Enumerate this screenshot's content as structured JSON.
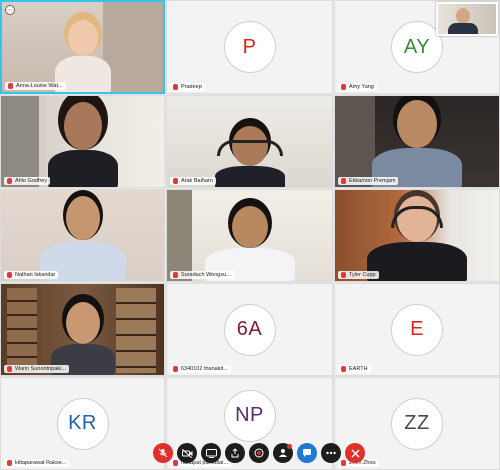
{
  "participants": [
    {
      "name": "Anna-Louise Wat...",
      "type": "video",
      "active": true
    },
    {
      "name": "Pradeep",
      "type": "avatar",
      "initials": "P",
      "color": "#d9231c"
    },
    {
      "name": "Amy Yang",
      "type": "avatar",
      "initials": "AY",
      "color": "#3a8a3e"
    },
    {
      "name": "Ahlo Godfrey",
      "type": "video"
    },
    {
      "name": "Arak Baiharn",
      "type": "video"
    },
    {
      "name": "Ekkamon Premjam",
      "type": "video"
    },
    {
      "name": "Nathan Iskandar",
      "type": "video"
    },
    {
      "name": "Suradach Wongsu...",
      "type": "video"
    },
    {
      "name": "Tyler Cupp",
      "type": "video"
    },
    {
      "name": "Warin Sunontnpaki...",
      "type": "video"
    },
    {
      "name": "6340102 thanakit...",
      "type": "avatar",
      "initials": "6A",
      "color": "#7a1d3a"
    },
    {
      "name": "EARTH",
      "type": "avatar",
      "initials": "E",
      "color": "#d9231c"
    },
    {
      "name": "kittaparawat Rakse...",
      "type": "avatar",
      "initials": "KR",
      "color": "#1f5fae"
    },
    {
      "name": "nattapat pannutai...",
      "type": "avatar",
      "initials": "NP",
      "color": "#5a2a6e"
    },
    {
      "name": "Zhen Zhou",
      "type": "avatar",
      "initials": "ZZ",
      "color": "#4a4a4a"
    }
  ],
  "menu_icon": "more-options-icon",
  "toolbar": [
    {
      "icon": "mic-off-icon",
      "style": "red"
    },
    {
      "icon": "video-off-icon",
      "style": "dark"
    },
    {
      "icon": "screen-share-icon",
      "style": "dark"
    },
    {
      "icon": "share-upload-icon",
      "style": "dark"
    },
    {
      "icon": "record-icon",
      "style": "dark"
    },
    {
      "icon": "participants-icon",
      "style": "dark",
      "badge": true
    },
    {
      "icon": "chat-icon",
      "style": "blue"
    },
    {
      "icon": "more-icon",
      "style": "dark"
    },
    {
      "icon": "leave-icon",
      "style": "red"
    }
  ]
}
